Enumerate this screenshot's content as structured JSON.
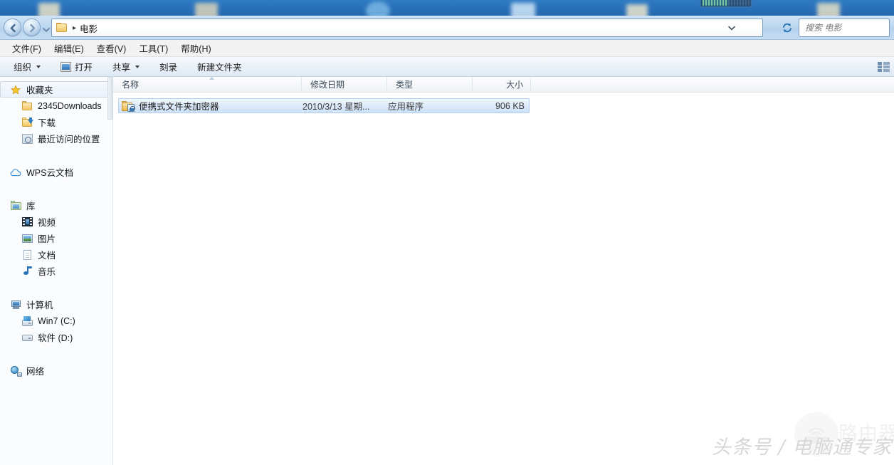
{
  "window": {
    "folder_name": "电影"
  },
  "desktop": {
    "gauge_label": "gauge-widget"
  },
  "addressbar": {
    "back_icon": "back-arrow-icon",
    "forward_icon": "forward-arrow-icon",
    "history_icon": "chevron-down-icon",
    "folder_icon": "folder-icon",
    "separator": "▸",
    "crumb": "电影",
    "dropdown_icon": "chevron-down-icon",
    "refresh_icon": "refresh-icon",
    "refresh_glyph": "↻",
    "search_placeholder": "搜索 电影",
    "search_value": ""
  },
  "menubar": {
    "items": [
      {
        "label": "文件(F)",
        "name": "menu-file"
      },
      {
        "label": "编辑(E)",
        "name": "menu-edit"
      },
      {
        "label": "查看(V)",
        "name": "menu-view"
      },
      {
        "label": "工具(T)",
        "name": "menu-tools"
      },
      {
        "label": "帮助(H)",
        "name": "menu-help"
      }
    ]
  },
  "toolbar": {
    "organize": "组织",
    "open": "打开",
    "share": "共享",
    "burn": "刻录",
    "new_folder": "新建文件夹",
    "open_icon": "open-window-icon",
    "viewmode_icon": "view-mode-icon"
  },
  "sidebar": {
    "groups": [
      {
        "name": "favorites",
        "header": {
          "label": "收藏夹",
          "icon": "star-icon",
          "selected": true
        },
        "items": [
          {
            "label": "2345Downloads",
            "icon": "folder-icon"
          },
          {
            "label": "下载",
            "icon": "downloads-folder-icon"
          },
          {
            "label": "最近访问的位置",
            "icon": "recent-places-icon"
          }
        ]
      },
      {
        "name": "wps",
        "header": {
          "label": "WPS云文档",
          "icon": "cloud-icon",
          "selected": false
        },
        "items": []
      },
      {
        "name": "libraries",
        "header": {
          "label": "库",
          "icon": "library-icon",
          "selected": false
        },
        "items": [
          {
            "label": "视频",
            "icon": "video-icon"
          },
          {
            "label": "图片",
            "icon": "picture-icon"
          },
          {
            "label": "文档",
            "icon": "document-icon"
          },
          {
            "label": "音乐",
            "icon": "music-icon"
          }
        ]
      },
      {
        "name": "computer",
        "header": {
          "label": "计算机",
          "icon": "computer-icon",
          "selected": false
        },
        "items": [
          {
            "label": "Win7 (C:)",
            "icon": "system-drive-icon"
          },
          {
            "label": "软件 (D:)",
            "icon": "drive-icon"
          }
        ]
      },
      {
        "name": "network",
        "header": {
          "label": "网络",
          "icon": "network-icon",
          "selected": false
        },
        "items": []
      }
    ]
  },
  "filelist": {
    "columns": [
      {
        "label": "名称",
        "name": "column-name"
      },
      {
        "label": "修改日期",
        "name": "column-date-modified"
      },
      {
        "label": "类型",
        "name": "column-type"
      },
      {
        "label": "大小",
        "name": "column-size"
      }
    ],
    "sort_column": "名称",
    "sort_direction": "ascending",
    "rows": [
      {
        "name": "便携式文件夹加密器",
        "date_modified": "2010/3/13 星期...",
        "type": "应用程序",
        "size": "906 KB",
        "icon": "encrypted-folder-icon",
        "selected": true
      }
    ]
  },
  "watermark": {
    "main": "头条号 / 电脑通专家",
    "logo_text": "路由器",
    "logo_icon": "router-wifi-icon"
  }
}
